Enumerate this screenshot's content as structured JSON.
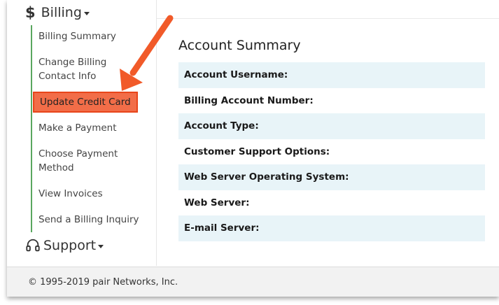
{
  "sidebar": {
    "billing": {
      "symbol": "$",
      "label": "Billing"
    },
    "items": [
      {
        "label": "Billing Summary"
      },
      {
        "label": "Change Billing"
      },
      {
        "label": "Contact Info"
      },
      {
        "label": "Update Credit Card"
      },
      {
        "label": "Make a Payment"
      },
      {
        "label": "Choose Payment"
      },
      {
        "label": "Method"
      },
      {
        "label": "View Invoices"
      },
      {
        "label": "Send a Billing Inquiry"
      }
    ],
    "support": {
      "label": "Support"
    }
  },
  "main": {
    "title": "Account Summary",
    "rows": [
      {
        "label": "Account Username:"
      },
      {
        "label": "Billing Account Number:"
      },
      {
        "label": "Account Type:"
      },
      {
        "label": "Customer Support Options:"
      },
      {
        "label": "Web Server Operating System:"
      },
      {
        "label": "Web Server:"
      },
      {
        "label": "E-mail Server:"
      }
    ]
  },
  "footer": {
    "text": "© 1995-2019 pair Networks, Inc."
  },
  "colors": {
    "highlight": "#f26d48",
    "arrow": "#f15a29",
    "nav_line": "#5aa75f",
    "row_shade": "#e8f4f8"
  },
  "icons": {
    "billing": "dollar-sign",
    "support": "headset-icon",
    "caret": "caret-down-icon"
  }
}
